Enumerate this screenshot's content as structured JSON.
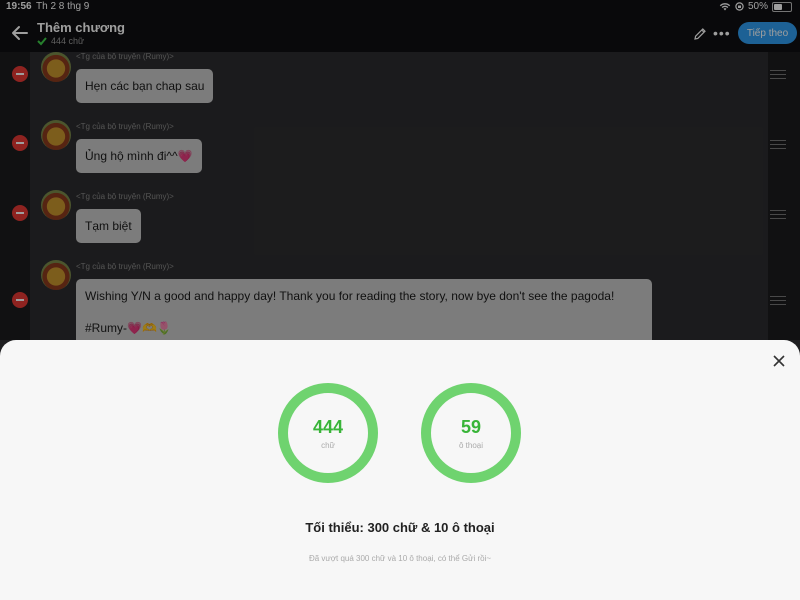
{
  "status_bar": {
    "time": "19:56",
    "date": "Th 2 8 thg 9",
    "battery": "50%",
    "battery_level": 0.5
  },
  "header": {
    "title": "Thêm chương",
    "word_count": "444 chữ",
    "next_label": "Tiếp theo"
  },
  "messages": [
    {
      "sender": "<Tg của bộ truyện (Rumy)>",
      "text": "Hẹn các bạn chap sau"
    },
    {
      "sender": "<Tg của bộ truyện (Rumy)>",
      "text": "Ủng hộ mình đi^^💗"
    },
    {
      "sender": "<Tg của bộ truyện (Rumy)>",
      "text": "Tạm biệt"
    },
    {
      "sender": "<Tg của bộ truyện (Rumy)>",
      "text": "Wishing Y/N a good and happy day! Thank you for reading the story, now bye don't see the pagoda!",
      "text2": "#Rumy-💗🫶🌷"
    }
  ],
  "stats": {
    "words": {
      "value": "444",
      "unit": "chữ"
    },
    "dialogues": {
      "value": "59",
      "unit": "ô thoại"
    },
    "minimum": "Tối thiểu: 300 chữ & 10 ô thoại",
    "note": "Đã vượt quá 300 chữ và 10 ô thoại, có thể Gửi rồi~"
  },
  "colors": {
    "accent": "#2f9df0",
    "ring": "#6fd36f",
    "remove": "#e53935"
  }
}
